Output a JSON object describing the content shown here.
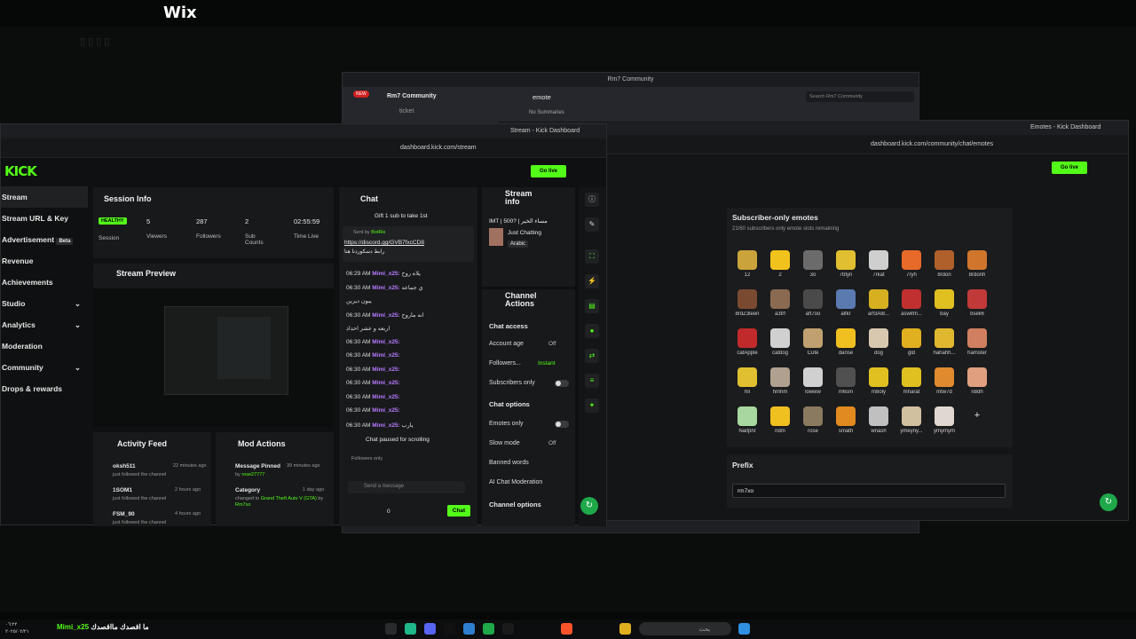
{
  "wix_logo": "Wix",
  "discord": {
    "title": "Rm7 Community",
    "new_badge": "NEW",
    "server_name": "Rm7 Community",
    "channel_ticket": "ticket",
    "channel_emote": "emote",
    "summaries": "No Summaries",
    "search_placeholder": "Search Rm7 Community"
  },
  "kick_right": {
    "tab_title": "Emotes - Kick Dashboard",
    "url": "dashboard.kick.com/community/chat/emotes",
    "go_live": "Go live",
    "section_title": "Subscriber-only emotes",
    "slots_text": "21/60 subscribers only emote slots remaining",
    "emotes": [
      {
        "name": "12",
        "color": "#caa43a"
      },
      {
        "name": "2",
        "color": "#f2c21c"
      },
      {
        "name": "3o",
        "color": "#6b6b6b"
      },
      {
        "name": "7btyn",
        "color": "#e0c030"
      },
      {
        "name": "7rkat",
        "color": "#cfcfcf"
      },
      {
        "name": "7ryh",
        "color": "#e86a2a"
      },
      {
        "name": "8rdon",
        "color": "#b0602a"
      },
      {
        "name": "8rdonh",
        "color": "#d0762c"
      },
      {
        "name": "8rdZ3leen",
        "color": "#7a4a30"
      },
      {
        "name": "a3trf",
        "color": "#8a6a50"
      },
      {
        "name": "aft7oo",
        "color": "#4a4a4a"
      },
      {
        "name": "alfkr",
        "color": "#5a7ab0"
      },
      {
        "name": "arf3Al8...",
        "color": "#d6b020"
      },
      {
        "name": "aswifm...",
        "color": "#c03030"
      },
      {
        "name": "bay",
        "color": "#e0c020"
      },
      {
        "name": "bseli6",
        "color": "#c03a3a"
      },
      {
        "name": "catApple",
        "color": "#c02a2a"
      },
      {
        "name": "catdog",
        "color": "#d0d0d0"
      },
      {
        "name": "Cute",
        "color": "#c0a070"
      },
      {
        "name": "danse",
        "color": "#f0c020"
      },
      {
        "name": "dog",
        "color": "#d8c8b0"
      },
      {
        "name": "gld",
        "color": "#e0b020"
      },
      {
        "name": "hahahh...",
        "color": "#e0b830"
      },
      {
        "name": "hamster",
        "color": "#d08060"
      },
      {
        "name": "hli",
        "color": "#e0c030"
      },
      {
        "name": "hmhm",
        "color": "#b0a090"
      },
      {
        "name": "lowww",
        "color": "#d0d0d0"
      },
      {
        "name": "m6sm",
        "color": "#505050"
      },
      {
        "name": "m8oly",
        "color": "#e0c020"
      },
      {
        "name": "mharat",
        "color": "#e0c020"
      },
      {
        "name": "mtw7d",
        "color": "#e08a30"
      },
      {
        "name": "n8dh",
        "color": "#e0a080"
      },
      {
        "name": "Naifpnr",
        "color": "#a8d8a0"
      },
      {
        "name": "ndm",
        "color": "#f0c020"
      },
      {
        "name": "rose",
        "color": "#8a7a60"
      },
      {
        "name": "smath",
        "color": "#e08a20"
      },
      {
        "name": "wnash",
        "color": "#c0c0c0"
      },
      {
        "name": "ymeyny...",
        "color": "#d0c0a0"
      },
      {
        "name": "ymymym",
        "color": "#e0d8d0"
      }
    ],
    "add_symbol": "+",
    "prefix_title": "Prefix",
    "prefix_value": "rm7xo"
  },
  "kick_left": {
    "tab_title": "Stream - Kick Dashboard",
    "url": "dashboard.kick.com/stream",
    "go_live": "Go live",
    "logo": "KICK",
    "nav": [
      {
        "label": "Stream",
        "selected": true
      },
      {
        "label": "Stream URL & Key"
      },
      {
        "label": "Advertisement",
        "badge": "Beta"
      },
      {
        "label": "Revenue"
      },
      {
        "label": "Achievements"
      },
      {
        "label": "Studio",
        "chevron": true
      },
      {
        "label": "Analytics",
        "chevron": true
      },
      {
        "label": "Moderation"
      },
      {
        "label": "Community",
        "chevron": true
      },
      {
        "label": "Drops & rewards"
      }
    ],
    "session": {
      "title": "Session Info",
      "health": "HEALTHY",
      "stats": [
        {
          "label": "Session",
          "value": ""
        },
        {
          "label": "Viewers",
          "value": "5"
        },
        {
          "label": "Followers",
          "value": "287"
        },
        {
          "label": "Sub Counts",
          "value": "2"
        },
        {
          "label": "Time Live",
          "value": "02:55:59"
        }
      ]
    },
    "preview_title": "Stream Preview",
    "activity": {
      "title": "Activity Feed",
      "items": [
        {
          "user": "oksh511",
          "text": "just followed the channel",
          "time": "22 minutes ago"
        },
        {
          "user": "1SOM1",
          "text": "just followed the channel",
          "time": "2 hours ago"
        },
        {
          "user": "FSM_90",
          "text": "just followed the channel",
          "time": "4 hours ago"
        }
      ]
    },
    "mod": {
      "title": "Mod Actions",
      "items": [
        {
          "title": "Message Pinned",
          "by_label": "by",
          "by": "rose27777",
          "time": "39 minutes ago"
        },
        {
          "title": "Category",
          "line2": "changed to",
          "game": "Grand Theft Auto V (GTA)",
          "by_label": "by",
          "by": "Rm7xo",
          "time": "1 day ago"
        }
      ]
    },
    "chat": {
      "title": "Chat",
      "gift": "Gift 1 sub to take 1st",
      "pinned_sent_by": "Sent by",
      "pinned_bot": "BotRix",
      "pinned_link": "https://discord.gg/GVB7fxcCD8",
      "pinned_text": "رابط دسكوردنا هنا",
      "messages": [
        {
          "time": "06:29 AM",
          "user": "Mimi_x25:",
          "text": "يلاه روح"
        },
        {
          "time": "06:30 AM",
          "user": "Mimi_x25:",
          "text": "ي جماعه"
        },
        {
          "time": "",
          "user": "",
          "text": "يبون ديرين"
        },
        {
          "time": "06:30 AM",
          "user": "Mimi_x25:",
          "text": "انه ماروح"
        },
        {
          "time": "",
          "user": "",
          "text": "اربعه و عشر احداد"
        },
        {
          "time": "06:30 AM",
          "user": "Mimi_x25:",
          "text": ""
        },
        {
          "time": "06:30 AM",
          "user": "Mimi_x25:",
          "text": ""
        },
        {
          "time": "06:30 AM",
          "user": "Mimi_x25:",
          "text": ""
        },
        {
          "time": "06:30 AM",
          "user": "Mimi_x25:",
          "text": ""
        },
        {
          "time": "06:30 AM",
          "user": "Mimi_x25:",
          "text": ""
        },
        {
          "time": "06:30 AM",
          "user": "Mimi_x25:",
          "text": ""
        },
        {
          "time": "06:30 AM",
          "user": "Mimi_x25:",
          "text": "يارب"
        }
      ],
      "paused": "Chat paused for scrolling",
      "followers_only": "Followers only",
      "send_placeholder": "Send a message",
      "count": "0",
      "chat_button": "Chat"
    },
    "stream_info": {
      "title": "Stream info",
      "stream_title": "IMT | 500? | مساء الخير",
      "category": "Just Chatting",
      "language": "Arabic"
    },
    "channel_actions": {
      "title": "Channel Actions",
      "chat_access": "Chat access",
      "account_age": "Account age",
      "account_age_val": "Off",
      "followers": "Followers...",
      "followers_val": "Instant",
      "subscribers_only": "Subscribers only",
      "chat_options": "Chat options",
      "emotes_only": "Emotes only",
      "slow_mode": "Slow mode",
      "slow_mode_val": "Off",
      "banned_words": "Banned words",
      "ai_mod": "AI Chat Moderation",
      "channel_options": "Channel options"
    }
  },
  "taskbar": {
    "time": "٠٦:٢٢",
    "date": "٢٠٢٥/٠٢/٢١",
    "stream_label": "Mimi_x25",
    "stream_text": "ما اقصدك مااقصدك",
    "search_text": "بحث"
  }
}
